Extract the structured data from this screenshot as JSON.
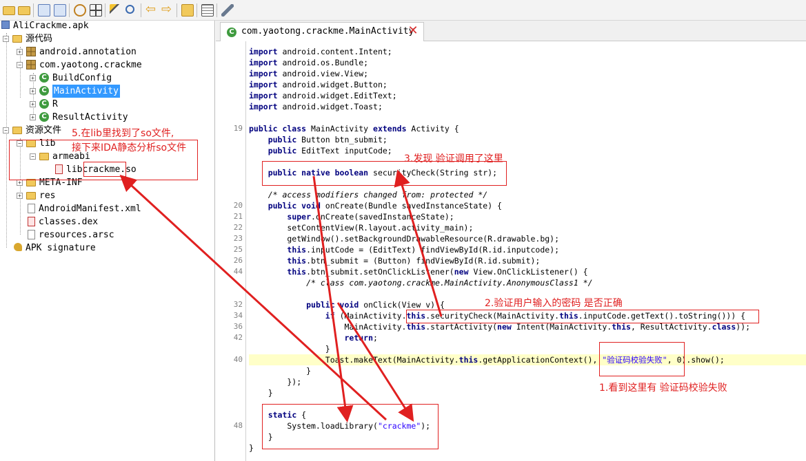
{
  "tree": {
    "root": "AliCrackme.apk",
    "source_code": "源代码",
    "pkg_annotation": "android.annotation",
    "pkg_crackme": "com.yaotong.crackme",
    "classes": [
      "BuildConfig",
      "MainActivity",
      "R",
      "ResultActivity"
    ],
    "resources": "资源文件",
    "lib": "lib",
    "armeabi": "armeabi",
    "so_file_prefix": "lib",
    "so_file_name": "crackme",
    "so_file_suffix": ".so",
    "meta_inf": "META-INF",
    "res": "res",
    "manifest": "AndroidManifest.xml",
    "classes_dex": "classes.dex",
    "resources_arsc": "resources.arsc",
    "apk_signature": "APK signature"
  },
  "editor": {
    "tab_title": "com.yaotong.crackme.MainActivity",
    "line_numbers": {
      "l19": "19",
      "l20": "20",
      "l21": "21",
      "l22": "22",
      "l23": "23",
      "l25": "25",
      "l26": "26",
      "l44": "44",
      "l32": "32",
      "l34": "34",
      "l36": "36",
      "l42": "42",
      "l40": "40",
      "l48": "48"
    },
    "imports": [
      "android.content.Intent;",
      "android.os.Bundle;",
      "android.view.View;",
      "android.widget.Button;",
      "android.widget.EditText;",
      "android.widget.Toast;"
    ],
    "comment_modifiers": "/* access modifiers changed from: protected */",
    "comment_anon": "/* class com.yaotong.crackme.MainActivity.AnonymousClass1 */",
    "toast_string": "\"验证码校验失败\"",
    "lib_string": "\"crackme\""
  },
  "annotations": {
    "note1": "1.看到这里有 验证码校验失败",
    "note2": "2.验证用户输入的密码 是否正确",
    "note3": "3.发现 验证调用了这里",
    "note5_line1": "5.在lib里找到了so文件,",
    "note5_line2": "接下来IDA静态分析so文件"
  },
  "colors": {
    "annotation_red": "#e02020",
    "selection_blue": "#3399ff",
    "keyword": "#00007f",
    "string": "#2a00ff",
    "comment": "#3f7f5f",
    "highlight_line": "#ffffc8"
  }
}
